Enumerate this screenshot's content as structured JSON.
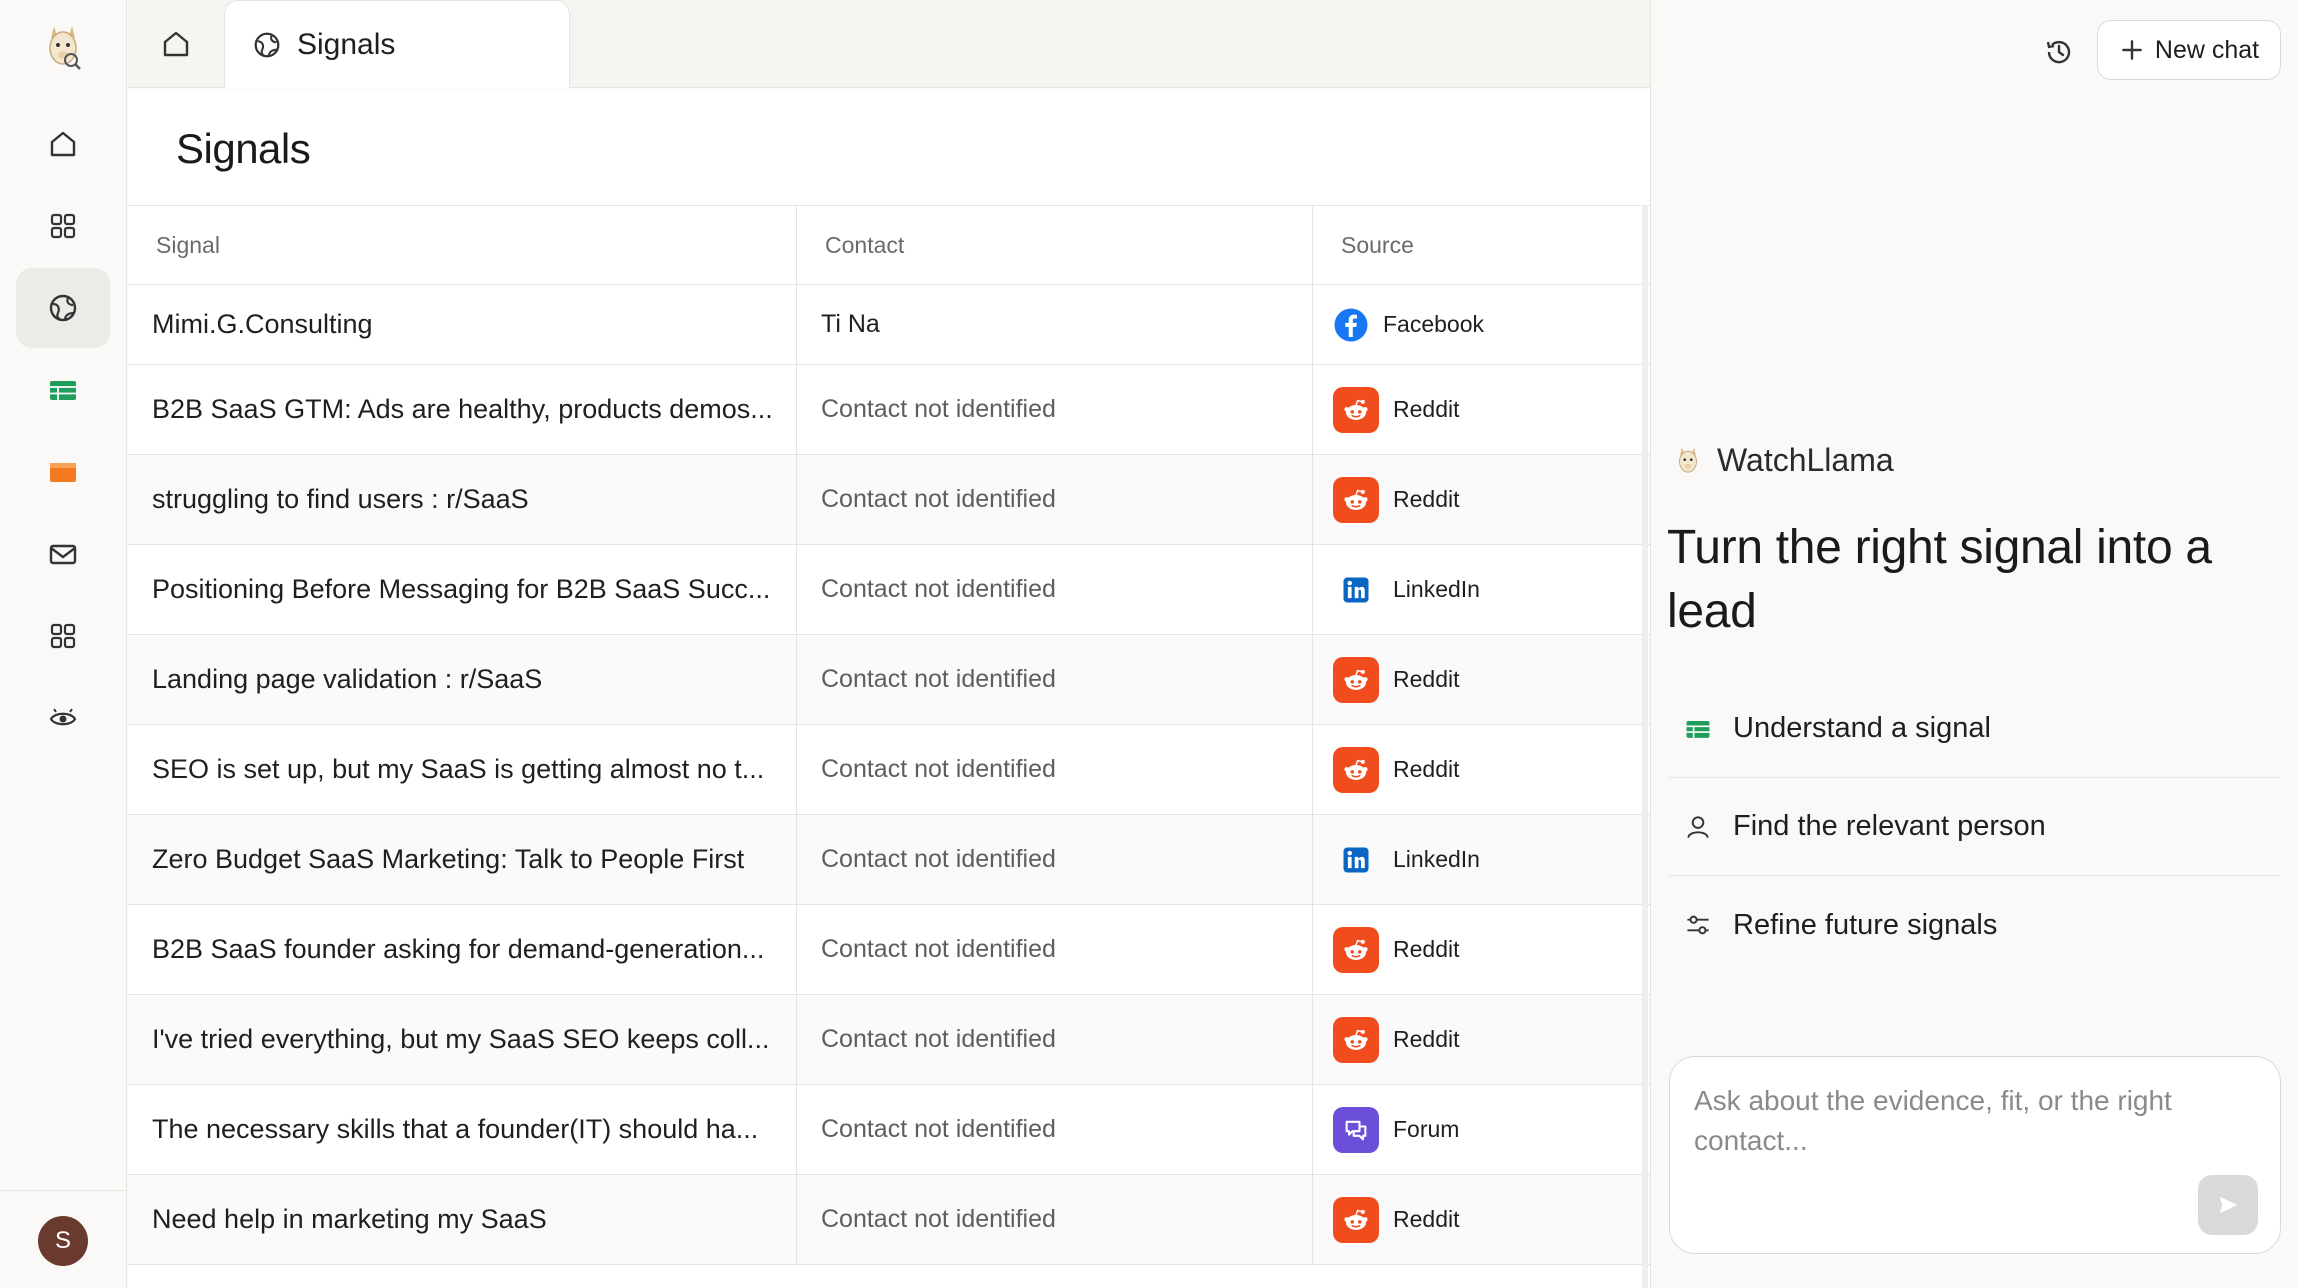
{
  "tabs": {
    "home_icon": "home-icon",
    "active_tab": {
      "label": "Signals",
      "icon": "globe-icon"
    }
  },
  "page": {
    "title": "Signals"
  },
  "table": {
    "headers": {
      "signal": "Signal",
      "contact": "Contact",
      "source": "Source"
    },
    "rows": [
      {
        "signal": "Mimi.G.Consulting",
        "contact": "Ti Na",
        "source": "Facebook",
        "source_type": "facebook"
      },
      {
        "signal": "B2B SaaS GTM: Ads are healthy, products demos...",
        "contact": "Contact not identified",
        "source": "Reddit",
        "source_type": "reddit"
      },
      {
        "signal": "struggling to find users : r/SaaS",
        "contact": "Contact not identified",
        "source": "Reddit",
        "source_type": "reddit"
      },
      {
        "signal": "Positioning Before Messaging for B2B SaaS Succ...",
        "contact": "Contact not identified",
        "source": "LinkedIn",
        "source_type": "linkedin"
      },
      {
        "signal": "Landing page validation : r/SaaS",
        "contact": "Contact not identified",
        "source": "Reddit",
        "source_type": "reddit"
      },
      {
        "signal": "SEO is set up, but my SaaS is getting almost no t...",
        "contact": "Contact not identified",
        "source": "Reddit",
        "source_type": "reddit"
      },
      {
        "signal": "Zero Budget SaaS Marketing: Talk to People First",
        "contact": "Contact not identified",
        "source": "LinkedIn",
        "source_type": "linkedin"
      },
      {
        "signal": "B2B SaaS founder asking for demand-generation...",
        "contact": "Contact not identified",
        "source": "Reddit",
        "source_type": "reddit"
      },
      {
        "signal": "I've tried everything, but my SaaS SEO keeps coll...",
        "contact": "Contact not identified",
        "source": "Reddit",
        "source_type": "reddit"
      },
      {
        "signal": "The necessary skills that a founder(IT) should ha...",
        "contact": "Contact not identified",
        "source": "Forum",
        "source_type": "forum"
      },
      {
        "signal": "Need help in marketing my SaaS",
        "contact": "Contact not identified",
        "source": "Reddit",
        "source_type": "reddit"
      }
    ]
  },
  "panel": {
    "new_chat_label": "New chat",
    "brand_name": "WatchLlama",
    "headline": "Turn the right signal into a lead",
    "suggestions": [
      {
        "label": "Understand a signal",
        "icon": "table-icon"
      },
      {
        "label": "Find the relevant person",
        "icon": "person-icon"
      },
      {
        "label": "Refine future signals",
        "icon": "sliders-icon"
      }
    ],
    "composer_placeholder": "Ask about the evidence, fit, or the right contact..."
  },
  "user": {
    "avatar_initial": "S"
  },
  "colors": {
    "reddit": "#f14c1e",
    "forum": "#6c4fd9",
    "linkedin": "#0a66c2",
    "facebook": "#1877f2",
    "accent_green": "#1e9e5a",
    "accent_orange": "#f47a1f"
  }
}
